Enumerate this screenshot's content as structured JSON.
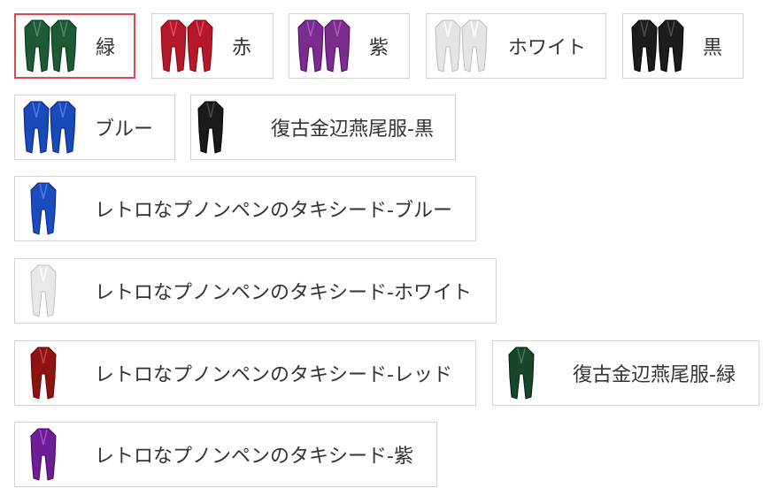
{
  "colors": {
    "selected_border": "#e0474c",
    "border": "#d4d4d4",
    "text": "#333333"
  },
  "options": [
    {
      "label": "緑",
      "color": "#1f5a36",
      "coats": 2,
      "selected": true
    },
    {
      "label": "赤",
      "color": "#b3182c",
      "coats": 2,
      "selected": false
    },
    {
      "label": "紫",
      "color": "#7a2d8c",
      "coats": 2,
      "selected": false
    },
    {
      "label": "ホワイト",
      "color": "#e4e4e4",
      "coats": 2,
      "selected": false
    },
    {
      "label": "黒",
      "color": "#1c1c1c",
      "coats": 2,
      "selected": false
    },
    {
      "label": "ブルー",
      "color": "#1a49b8",
      "coats": 2,
      "selected": false
    },
    {
      "label": "復古金辺燕尾服-黒",
      "color": "#1a1a1a",
      "coats": 1,
      "selected": false
    },
    {
      "label": "レトロなプノンペンのタキシード-ブルー",
      "color": "#1c4cbc",
      "coats": 1,
      "selected": false
    },
    {
      "label": "レトロなプノンペンのタキシード-ホワイト",
      "color": "#e8e8e8",
      "coats": 1,
      "selected": false
    },
    {
      "label": "レトロなプノンペンのタキシード-レッド",
      "color": "#8e1412",
      "coats": 1,
      "selected": false
    },
    {
      "label": "復古金辺燕尾服-緑",
      "color": "#17462c",
      "coats": 1,
      "selected": false
    },
    {
      "label": "レトロなプノンペンのタキシード-紫",
      "color": "#6d1e96",
      "coats": 1,
      "selected": false
    }
  ]
}
